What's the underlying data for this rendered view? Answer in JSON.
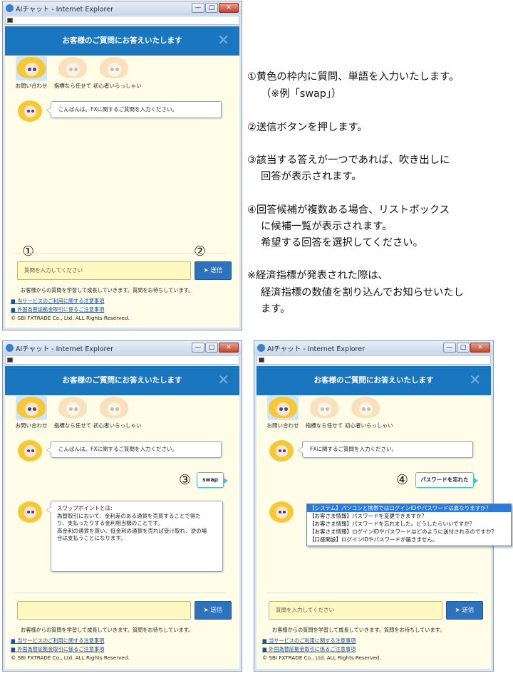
{
  "window": {
    "title": "AIチャット - Internet Explorer",
    "controls": [
      "—",
      "□",
      "✕"
    ]
  },
  "header": {
    "title": "お客様のご質問にお答えいたします",
    "close": "✕"
  },
  "tabs": [
    {
      "label": "お問い合わせ"
    },
    {
      "label": "指標なら任せて"
    },
    {
      "label": "初心者いらっしゃい"
    }
  ],
  "input_placeholder": "質問を入力してください",
  "send_label": "送信",
  "send_icon": "paper-plane-icon",
  "note": "お客様からの質問を学習して成長していきます。質問をお待ちしています。",
  "links": [
    "当サービスのご利用に関する注意事項",
    "外国為替証拠金取引に係るご注意事項"
  ],
  "copyright": "© SBI FXTRADE Co., Ltd. ALL Rights Reserved.",
  "screen1": {
    "greeting": "こんばんは。FXに関するご質問を入力ください。",
    "marker1": "①",
    "marker2": "②"
  },
  "screen2": {
    "greeting": "こんばんは。FXに関するご質問を入力ください。",
    "marker": "③",
    "user_msg": "swap",
    "answer_lines": [
      "スワップポイントとは:",
      "為替取引において、金利差のある通貨を売買することで得た",
      "り、支払ったりする金利相当額のことです。",
      "高金利の通貨を買い、低金利の通貨を売れば受け取れ、逆の場",
      "合は支払うことになります。"
    ],
    "input_value": ""
  },
  "screen3": {
    "greeting": "FXに関するご質問を入力ください。",
    "marker": "④",
    "user_msg": "パスワードを忘れた",
    "options": [
      "【システム】パソコンと携帯ではログインIDやパスワードは異なりますか？",
      "【お客さま情報】パスワードを変更できますか？",
      "【お客さま情報】パスワードを忘れました。どうしたらいいですか？",
      "【お客さま情報】ログインIDやパスワードはどのように送付されるのですか？",
      "【口座開設】ログインIDやパスワードが届きません。"
    ]
  },
  "instructions": [
    "①黄色の枠内に質問、単語を入力いたします。",
    "（※例「swap」）",
    "②送信ボタンを押します。",
    "③該当する答えが一つであれば、吹き出しに",
    "回答が表示されます。",
    "④回答候補が複数ある場合、リストボックス",
    "に候補一覧が表示されます。",
    "希望する回答を選択してください。",
    "※経済指標が発表された際は、",
    "経済指標の数値を割り込んでお知らせいたし",
    "ます。"
  ]
}
